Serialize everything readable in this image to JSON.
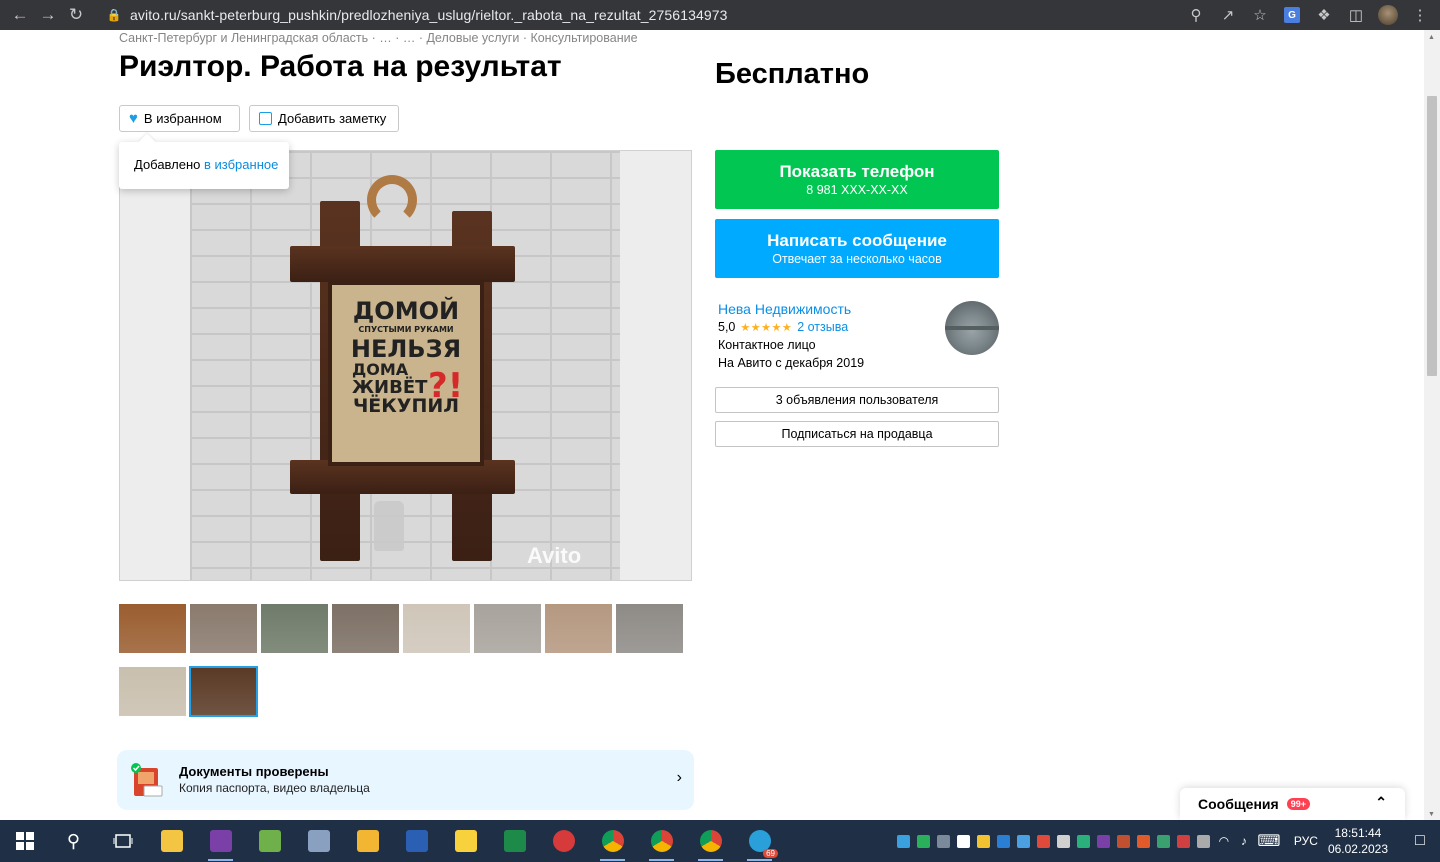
{
  "browser": {
    "url": "avito.ru/sankt-peterburg_pushkin/predlozheniya_uslug/rieltor._rabota_na_rezultat_2756134973",
    "ext_translate_label": "G"
  },
  "listing": {
    "breadcrumb": "Санкт-Петербург и Ленинградская область · … · … · Деловые услуги · Консультирование",
    "title": "Риэлтор. Работа на результат",
    "price": "Бесплатно",
    "favorite_button": "В избранном",
    "note_button": "Добавить заметку",
    "tooltip_prefix": "Добавлено ",
    "tooltip_link": "в избранное",
    "photo_sign_lines": [
      "ДОМОЙ",
      "СПУСТЫМИ РУКАМИ",
      "НЕЛЬЗЯ",
      "ДОМА",
      "ЖИВЁТ",
      "ЧЁКУПИЛ"
    ],
    "photo_sign_mark": "?!",
    "watermark": "Avito",
    "thumbnails_row1": [
      {
        "name": "cat",
        "color": "#9a5e30"
      },
      {
        "name": "building-1",
        "color": "#8a7a6e"
      },
      {
        "name": "building-2",
        "color": "#6f7b6a"
      },
      {
        "name": "building-3",
        "color": "#7d7065"
      },
      {
        "name": "room-1",
        "color": "#cfc6b9"
      },
      {
        "name": "room-2",
        "color": "#a8a39c"
      },
      {
        "name": "room-3",
        "color": "#b59880"
      },
      {
        "name": "room-4",
        "color": "#8e8b87"
      }
    ],
    "thumbnails_row2": [
      {
        "name": "room-5",
        "color": "#c9bfae"
      },
      {
        "name": "sign",
        "color": "#5a3a26"
      }
    ]
  },
  "documents": {
    "title": "Документы проверены",
    "subtitle": "Копия паспорта, видео владельца"
  },
  "contact": {
    "phone_button": "Показать телефон",
    "phone_masked": "8 981 XXX-XX-XX",
    "message_button": "Написать сообщение",
    "message_sub": "Отвечает за несколько часов"
  },
  "seller": {
    "name": "Нева Недвижимость",
    "rating": "5,0",
    "stars": "★★★★★",
    "reviews": "2 отзыва",
    "role": "Контактное лицо",
    "since": "На Авито с декабря 2019",
    "listings_button": "3 объявления пользователя",
    "subscribe_button": "Подписаться на продавца"
  },
  "messenger": {
    "label": "Сообщения",
    "count": "99+"
  },
  "taskbar": {
    "apps": [
      {
        "name": "file-explorer-icon",
        "color": "#f4c542"
      },
      {
        "name": "onenote-icon",
        "color": "#7b3fa8"
      },
      {
        "name": "notepad-icon",
        "color": "#6fb04a"
      },
      {
        "name": "network-icon",
        "color": "#8aa0c0"
      },
      {
        "name": "folder-icon",
        "color": "#f2b632"
      },
      {
        "name": "word-icon",
        "color": "#2b5fb4"
      },
      {
        "name": "sticky-notes-icon",
        "color": "#f7d23c"
      },
      {
        "name": "excel-icon",
        "color": "#1e8a4a"
      },
      {
        "name": "yandex-icon",
        "color": "#d73a3a"
      },
      {
        "name": "chrome-icon-1",
        "color": "#e0a020"
      },
      {
        "name": "chrome-icon-2",
        "color": "#e0a020"
      },
      {
        "name": "chrome-icon-3",
        "color": "#e0a020"
      },
      {
        "name": "telegram-icon",
        "color": "#2aa0da"
      }
    ],
    "telegram_badge": "69",
    "tray_colors": [
      "#3aa0e0",
      "#2ab05a",
      "#7a8a9a",
      "#ffffff",
      "#f2c230",
      "#2a7fd4",
      "#4aa0e0",
      "#e04a3a",
      "#d0d0d0",
      "#2ab07a",
      "#7b3fa8",
      "#c05030",
      "#e05a2a",
      "#3aa070",
      "#d04040",
      "#aaaaaa"
    ],
    "language": "РУС",
    "time": "18:51:44",
    "date": "06.02.2023"
  }
}
